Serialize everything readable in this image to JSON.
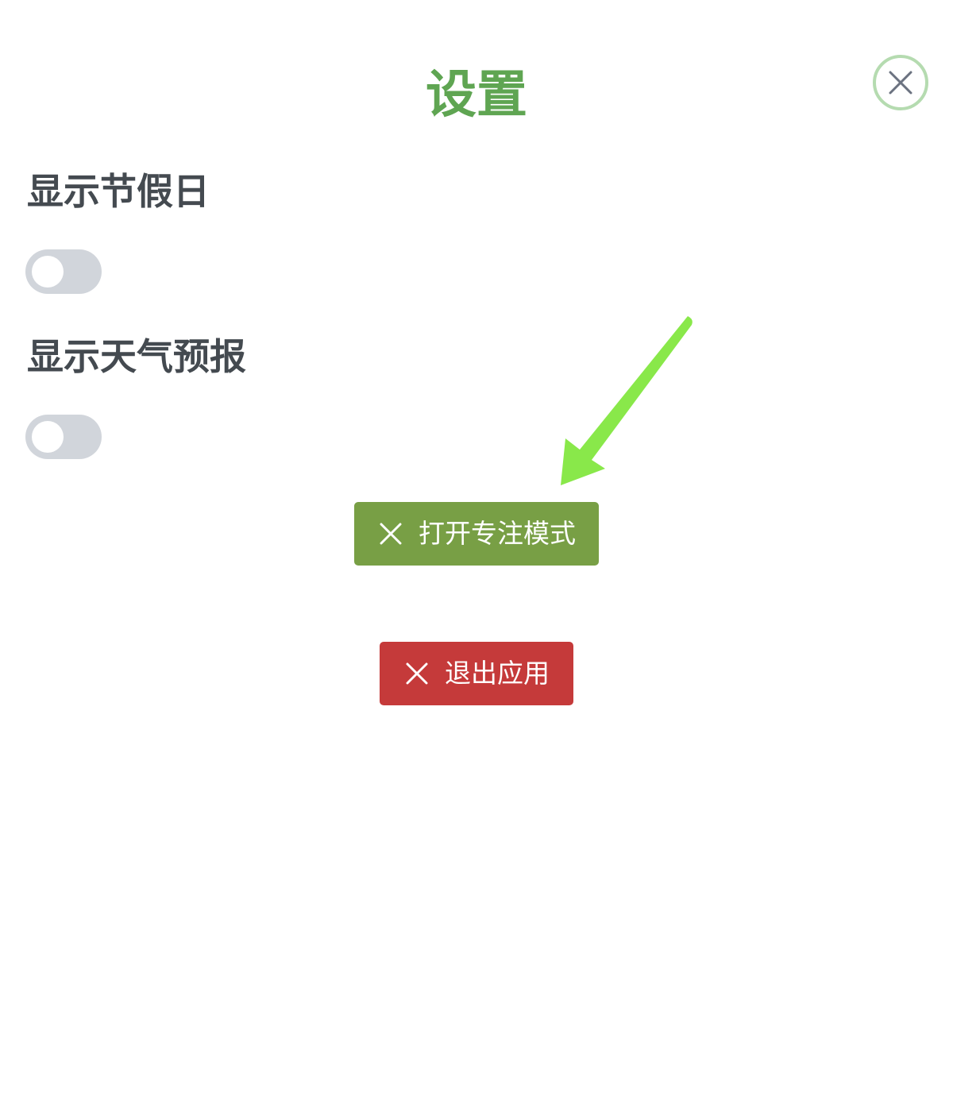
{
  "header": {
    "title": "设置"
  },
  "settings": [
    {
      "label": "显示节假日",
      "enabled": false
    },
    {
      "label": "显示天气预报",
      "enabled": false
    }
  ],
  "actions": {
    "focus_mode": {
      "label": "打开专注模式",
      "icon": "close-icon"
    },
    "exit_app": {
      "label": "退出应用",
      "icon": "close-icon"
    }
  },
  "annotation": {
    "icon": "green-arrow-icon"
  },
  "colors": {
    "title": "#5fa552",
    "close_border": "#b5dbb0",
    "close_icon": "#6b7280",
    "label": "#444a50",
    "toggle_off": "#d1d5db",
    "focus_button": "#789f45",
    "exit_button": "#c53a3a",
    "arrow": "#89e84a"
  }
}
